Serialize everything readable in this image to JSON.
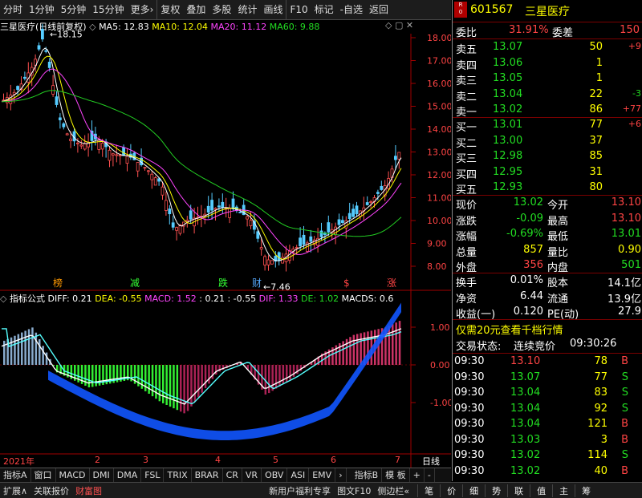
{
  "toolbar": {
    "items": [
      "分时",
      "1分钟",
      "5分钟",
      "15分钟",
      "更多›",
      "复权",
      "叠加",
      "多股",
      "统计",
      "画线",
      "F10",
      "标记",
      "-自选",
      "返回"
    ]
  },
  "main": {
    "name": "三星医疗",
    "adj": "(日线前复权)",
    "ma5": "MA5: 12.83",
    "ma10": "MA10: 12.04",
    "ma20": "MA20: 11.12",
    "ma60": "MA60: 9.88",
    "yticks": [
      "18.00",
      "17.00",
      "16.00",
      "15.00",
      "14.00",
      "13.00",
      "12.00",
      "11.00",
      "10.00",
      "9.00",
      "8.00"
    ],
    "high_label": "18.15",
    "low_label": "7.46",
    "events": [
      "榜",
      "减",
      "跌",
      "财",
      "$",
      "涨"
    ]
  },
  "indicator": {
    "title": "指标公式",
    "diff": "DIFF: 0.21",
    "dea": "DEA: -0.55",
    "macd": "MACD: 1.52",
    "v1": ": 0.21",
    "v2": ": -0.55",
    "dif": "DIF: 1.33",
    "de": "DE: 1.02",
    "macds": "MACDS: 0.6",
    "yticks": [
      "1.00",
      "0.00",
      "-1.00"
    ]
  },
  "xaxis": {
    "labels": [
      "2021年",
      "2",
      "3",
      "4",
      "5",
      "6",
      "7"
    ],
    "period": "日线"
  },
  "bottom_tabs": [
    "指标A",
    "窗口",
    "MACD",
    "DMI",
    "DMA",
    "FSL",
    "TRIX",
    "BRAR",
    "CR",
    "VR",
    "OBV",
    "ASI",
    "EMV",
    "›",
    "指标B",
    "模 板",
    "+",
    "-"
  ],
  "status": {
    "items": [
      "扩展∧",
      "关联报价",
      "财富图"
    ],
    "promo": "新用户福利专享",
    "right": [
      "图文F10",
      "侧边栏«"
    ],
    "bottom_buttons": [
      "笔",
      "价",
      "细",
      "势",
      "联",
      "值",
      "主",
      "筹"
    ]
  },
  "quote": {
    "code": "601567",
    "name": "三星医疗",
    "webi_label": "委比",
    "webi": "31.91%",
    "weicha_label": "委差",
    "weicha": "150",
    "asks": [
      {
        "label": "卖五",
        "price": "13.07",
        "vol": "50",
        "chg": "+9"
      },
      {
        "label": "卖四",
        "price": "13.06",
        "vol": "1",
        "chg": ""
      },
      {
        "label": "卖三",
        "price": "13.05",
        "vol": "1",
        "chg": ""
      },
      {
        "label": "卖二",
        "price": "13.04",
        "vol": "22",
        "chg": "-3"
      },
      {
        "label": "卖一",
        "price": "13.02",
        "vol": "86",
        "chg": "+77"
      }
    ],
    "bids": [
      {
        "label": "买一",
        "price": "13.01",
        "vol": "77",
        "chg": "+6"
      },
      {
        "label": "买二",
        "price": "13.00",
        "vol": "37",
        "chg": ""
      },
      {
        "label": "买三",
        "price": "12.98",
        "vol": "85",
        "chg": ""
      },
      {
        "label": "买四",
        "price": "12.95",
        "vol": "31",
        "chg": ""
      },
      {
        "label": "买五",
        "price": "12.93",
        "vol": "80",
        "chg": ""
      }
    ],
    "stats": [
      {
        "l1": "现价",
        "v1": "13.02",
        "l2": "今开",
        "v2": "13.10"
      },
      {
        "l1": "涨跌",
        "v1": "-0.09",
        "l2": "最高",
        "v2": "13.10"
      },
      {
        "l1": "涨幅",
        "v1": "-0.69%",
        "l2": "最低",
        "v2": "13.01"
      },
      {
        "l1": "总量",
        "v1": "857",
        "l2": "量比",
        "v2": "0.90"
      },
      {
        "l1": "外盘",
        "v1": "356",
        "l2": "内盘",
        "v2": "501"
      }
    ],
    "stats2": [
      {
        "l1": "换手",
        "v1": "0.01%",
        "l2": "股本",
        "v2": "14.1亿"
      },
      {
        "l1": "净资",
        "v1": "6.44",
        "l2": "流通",
        "v2": "13.9亿"
      },
      {
        "l1": "收益(一)",
        "v1": "0.120",
        "l2": "PE(动)",
        "v2": "27.9"
      }
    ],
    "ad": "仅需20元查看千档行情",
    "trade_status_label": "交易状态:",
    "trade_status": "连续竞价",
    "trade_time": "09:30:26",
    "ticks": [
      {
        "t": "09:30",
        "p": "13.10",
        "v": "78",
        "s": "B"
      },
      {
        "t": "09:30",
        "p": "13.07",
        "v": "77",
        "s": "S"
      },
      {
        "t": "09:30",
        "p": "13.04",
        "v": "83",
        "s": "S"
      },
      {
        "t": "09:30",
        "p": "13.04",
        "v": "92",
        "s": "S"
      },
      {
        "t": "09:30",
        "p": "13.04",
        "v": "121",
        "s": "B"
      },
      {
        "t": "09:30",
        "p": "13.03",
        "v": "3",
        "s": "B"
      },
      {
        "t": "09:30",
        "p": "13.02",
        "v": "114",
        "s": "S"
      },
      {
        "t": "09:30",
        "p": "13.02",
        "v": "40",
        "s": "B"
      }
    ]
  }
}
